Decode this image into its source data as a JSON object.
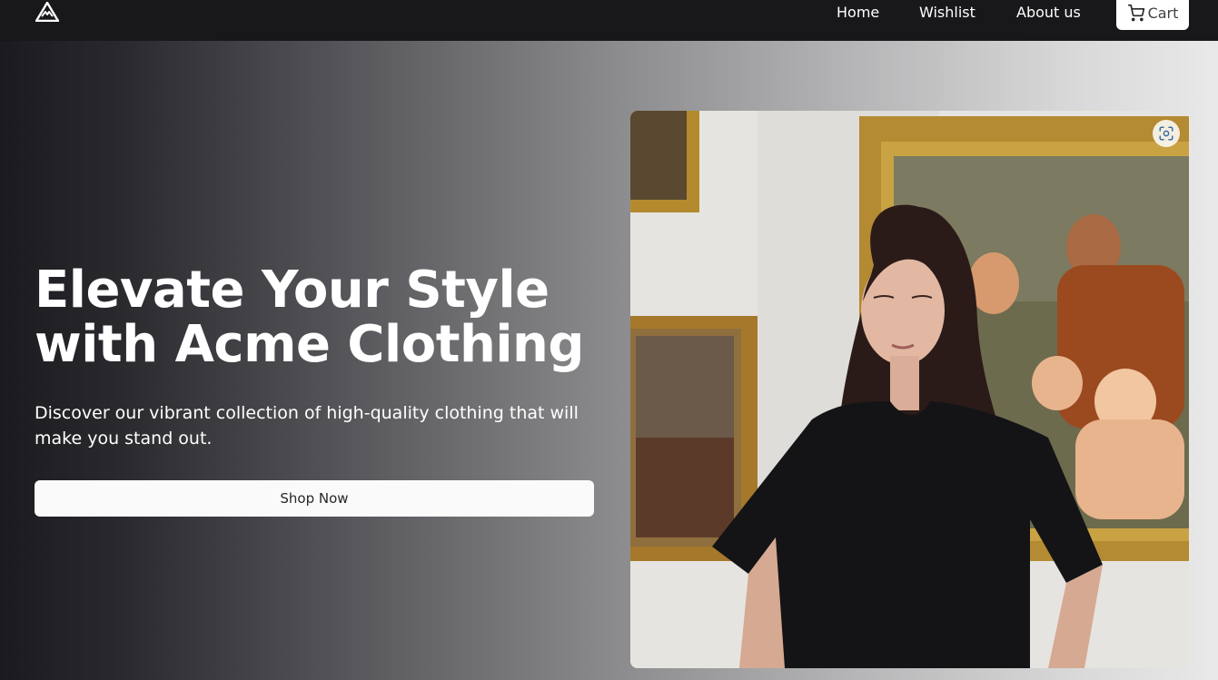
{
  "brand": {
    "logo_icon": "mountain-triangle-logo"
  },
  "nav": {
    "home": "Home",
    "wishlist": "Wishlist",
    "about": "About us",
    "cart": "Cart",
    "cart_icon": "shopping-cart-icon"
  },
  "hero": {
    "headline_line1": "Elevate Your Style",
    "headline_line2": "with Acme Clothing",
    "subtext": "Discover our vibrant collection of high-quality clothing that will make you stand out.",
    "cta": "Shop Now",
    "image_icon": "visual-search-lens-icon"
  },
  "colors": {
    "topbar": "#18181b",
    "button_bg": "#fafafa",
    "text_light": "#ffffff"
  }
}
